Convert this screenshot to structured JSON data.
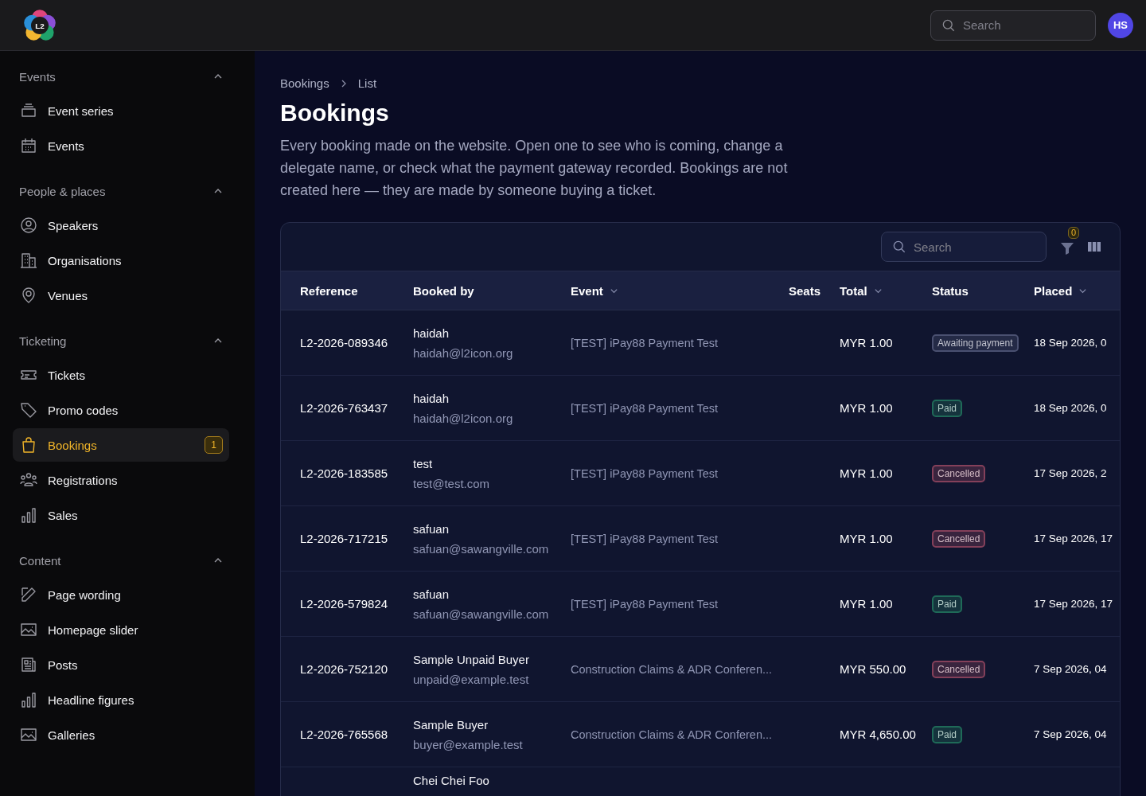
{
  "topbar": {
    "logo": "L2",
    "search": {
      "placeholder": "Search"
    },
    "avatar": "HS"
  },
  "sidebar": {
    "sections": [
      {
        "title": "Events",
        "expanded": true,
        "items": [
          {
            "label": "Event series",
            "selected": false
          },
          {
            "label": "Events",
            "selected": false
          }
        ]
      },
      {
        "title": "People & places",
        "expanded": true,
        "items": [
          {
            "label": "Speakers",
            "selected": false
          },
          {
            "label": "Organisations",
            "selected": false
          },
          {
            "label": "Venues",
            "selected": false
          }
        ]
      },
      {
        "title": "Ticketing",
        "expanded": true,
        "items": [
          {
            "label": "Tickets",
            "selected": false
          },
          {
            "label": "Promo codes",
            "selected": false
          },
          {
            "label": "Bookings",
            "selected": true,
            "badge": "1"
          },
          {
            "label": "Registrations",
            "selected": false
          },
          {
            "label": "Sales",
            "selected": false
          }
        ]
      },
      {
        "title": "Content",
        "expanded": true,
        "items": [
          {
            "label": "Page wording",
            "selected": false
          },
          {
            "label": "Homepage slider",
            "selected": false
          },
          {
            "label": "Posts",
            "selected": false
          },
          {
            "label": "Headline figures",
            "selected": false
          },
          {
            "label": "Galleries",
            "selected": false
          }
        ]
      }
    ]
  },
  "breadcrumb": [
    "Bookings",
    "List"
  ],
  "title": "Bookings",
  "description": "Every booking made on the website. Open one to see who is coming, change a delegate name, or check what the payment gateway recorded. Bookings are not created here — they are made by someone buying a ticket.",
  "table": {
    "search": {
      "placeholder": "Search"
    },
    "filter_count": "0",
    "columns": [
      {
        "label": "Reference",
        "sortable": false
      },
      {
        "label": "Booked by",
        "sortable": false
      },
      {
        "label": "Event",
        "sortable": true
      },
      {
        "label": "Seats",
        "sortable": false
      },
      {
        "label": "Total",
        "sortable": true
      },
      {
        "label": "Status",
        "sortable": false
      },
      {
        "label": "Placed",
        "sortable": true
      }
    ],
    "rows": [
      {
        "reference": "L2-2026-089346",
        "name": "haidah",
        "email": "haidah@l2icon.org",
        "event": "[TEST] iPay88 Payment Test",
        "total": "MYR 1.00",
        "status": "Awaiting payment",
        "color": "#4a5070",
        "placed": "18 Sep 2026, 0"
      },
      {
        "reference": "L2-2026-763437",
        "name": "haidah",
        "email": "haidah@l2icon.org",
        "event": "[TEST] iPay88 Payment Test",
        "total": "MYR 1.00",
        "status": "Paid",
        "color": "#1f6a58",
        "placed": "18 Sep 2026, 0"
      },
      {
        "reference": "L2-2026-183585",
        "name": "test",
        "email": "test@test.com",
        "event": "[TEST] iPay88 Payment Test",
        "total": "MYR 1.00",
        "status": "Cancelled",
        "color": "#84405a",
        "placed": "17 Sep 2026, 2"
      },
      {
        "reference": "L2-2026-717215",
        "name": "safuan",
        "email": "safuan@sawangville.com",
        "event": "[TEST] iPay88 Payment Test",
        "total": "MYR 1.00",
        "status": "Cancelled",
        "color": "#84405a",
        "placed": "17 Sep 2026, 17"
      },
      {
        "reference": "L2-2026-579824",
        "name": "safuan",
        "email": "safuan@sawangville.com",
        "event": "[TEST] iPay88 Payment Test",
        "total": "MYR 1.00",
        "status": "Paid",
        "color": "#1f6a58",
        "placed": "17 Sep 2026, 17"
      },
      {
        "reference": "L2-2026-752120",
        "name": "Sample Unpaid Buyer",
        "email": "unpaid@example.test",
        "event": "Construction Claims & ADR Conferen...",
        "total": "MYR 550.00",
        "status": "Cancelled",
        "color": "#84405a",
        "placed": "7 Sep 2026, 04"
      },
      {
        "reference": "L2-2026-765568",
        "name": "Sample Buyer",
        "email": "buyer@example.test",
        "event": "Construction Claims & ADR Conferen...",
        "total": "MYR 4,650.00",
        "status": "Paid",
        "color": "#1f6a58",
        "placed": "7 Sep 2026, 04"
      },
      {
        "name": "Chei Chei Foo"
      }
    ]
  }
}
